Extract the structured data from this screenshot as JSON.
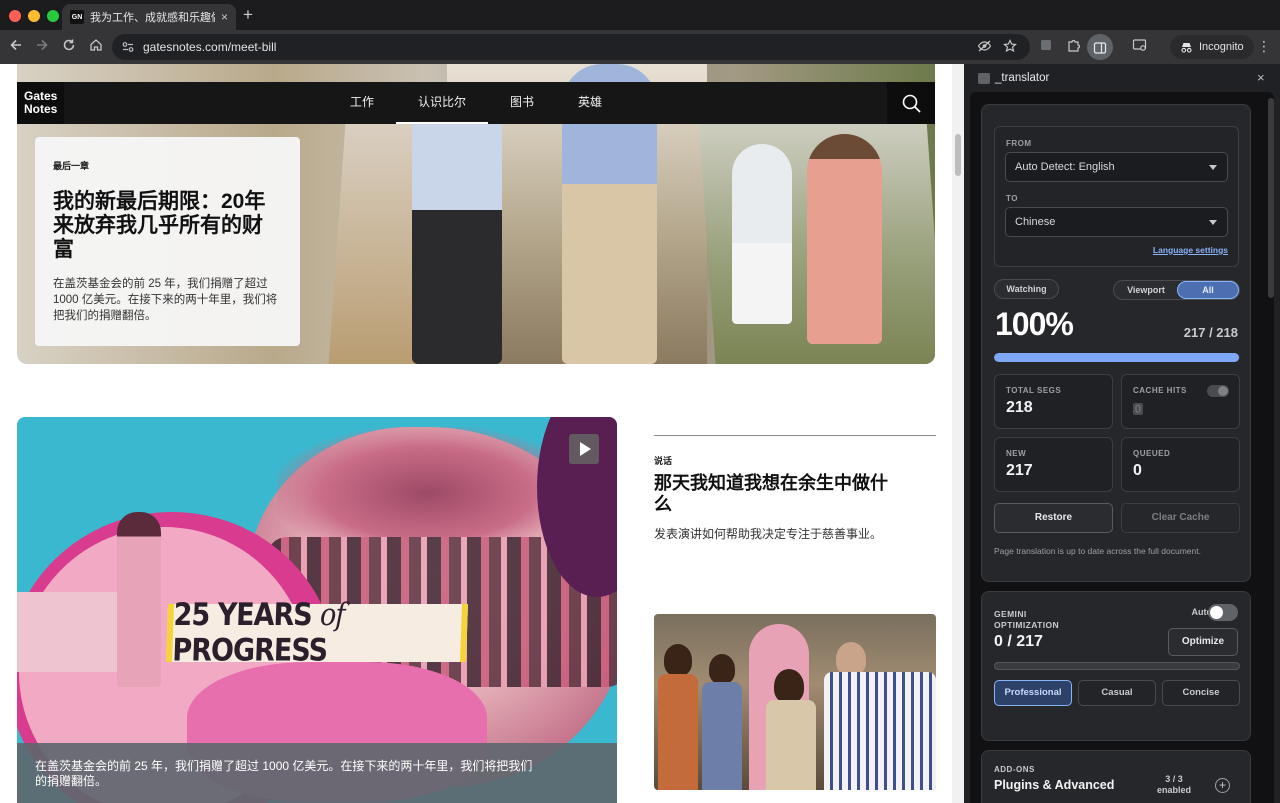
{
  "browser": {
    "tab_favicon": "GN",
    "tab_title": "我为工作、成就感和乐趣做什么",
    "tab_close": "×",
    "new_tab": "+",
    "url": "gatesnotes.com/meet-bill",
    "incognito_label": "Incognito",
    "icons": [
      "back-icon",
      "forward-icon",
      "reload-icon",
      "home-icon",
      "site-info-icon",
      "eye-off-icon",
      "star-icon",
      "extension-icon",
      "puzzle-icon",
      "side-panel-icon",
      "cast-icon",
      "incognito-icon",
      "menu-icon"
    ]
  },
  "site": {
    "logo_line1": "Gates",
    "logo_line2": "Notes",
    "nav": [
      {
        "label": "工作",
        "active": false
      },
      {
        "label": "认识比尔",
        "active": true
      },
      {
        "label": "图书",
        "active": false
      },
      {
        "label": "英雄",
        "active": false
      }
    ],
    "hero": {
      "kicker": "最后一章",
      "title": "我的新最后期限：20年来放弃我几乎所有的财富",
      "desc": "在盖茨基金会的前 25 年，我们捐赠了超过 1000 亿美元。在接下来的两十年里，我们将把我们的捐赠翻倍。"
    },
    "video": {
      "banner_pre": "25 YEARS ",
      "banner_of": "of",
      "banner_post": " PROGRESS",
      "caption": "在盖茨基金会的前 25 年，我们捐赠了超过 1000 亿美元。在接下来的两十年里，我们将把我们的捐赠翻倍。"
    },
    "side_story": {
      "kicker": "说话",
      "title": "那天我知道我想在余生中做什么",
      "desc": "发表演讲如何帮助我决定专注于慈善事业。"
    }
  },
  "panel": {
    "title": "_translator",
    "close": "×",
    "from_label": "FROM",
    "from_value": "Auto Detect: English",
    "to_label": "TO",
    "to_value": "Chinese",
    "language_settings": "Language settings",
    "watching_label": "Watching",
    "scope_viewport": "Viewport",
    "scope_all": "All",
    "percent": "100%",
    "progress_text": "217 / 218",
    "progress_fraction": 0.995,
    "stats": {
      "total_label": "TOTAL SEGS",
      "total_value": "218",
      "cache_label": "CACHE HITS",
      "cache_value": "0",
      "new_label": "NEW",
      "new_value": "217",
      "queued_label": "QUEUED",
      "queued_value": "0"
    },
    "restore_label": "Restore",
    "clear_cache_label": "Clear Cache",
    "status": "Page translation is up to date across the full document.",
    "gemini_label": "GEMINI OPTIMIZATION",
    "gemini_count": "0 / 217",
    "auto_label": "Auto",
    "optimize_label": "Optimize",
    "modes": [
      {
        "label": "Professional",
        "active": true
      },
      {
        "label": "Casual",
        "active": false
      },
      {
        "label": "Concise",
        "active": false
      }
    ],
    "addons_label": "ADD-ONS",
    "addons_title": "Plugins & Advanced",
    "addons_count": "3 / 3",
    "addons_enabled": "enabled",
    "addons_plus": "+",
    "accent_color": "#8ab4f8"
  }
}
